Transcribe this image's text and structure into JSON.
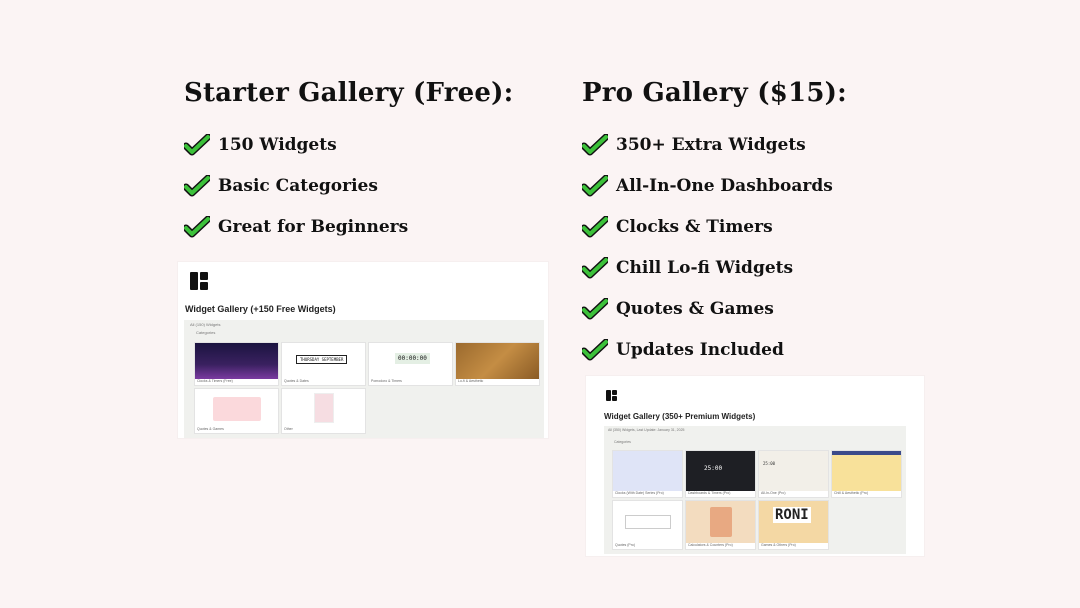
{
  "starter": {
    "heading": "Starter Gallery (Free):",
    "features": [
      "150 Widgets",
      "Basic Categories",
      "Great for Beginners"
    ],
    "screenshot": {
      "title": "Widget Gallery (+150 Free Widgets)",
      "board_label": "All (150) Widgets",
      "board_sub": "Categories",
      "cards": [
        {
          "caption": "Clocks & Timers (Free)",
          "thumb_text": ""
        },
        {
          "caption": "Quotes & Dates",
          "thumb_text": "THURSDAY  SEPTEMBER"
        },
        {
          "caption": "Pomodoro & Timers",
          "thumb_text": "00:00:00"
        },
        {
          "caption": "Lo-fi & Aesthetic",
          "thumb_text": ""
        },
        {
          "caption": "Quotes & Games",
          "thumb_text": ""
        },
        {
          "caption": "Other",
          "thumb_text": ""
        }
      ]
    }
  },
  "pro": {
    "heading": "Pro Gallery ($15):",
    "features": [
      "350+ Extra Widgets",
      "All-In-One Dashboards",
      "Clocks & Timers",
      "Chill Lo-fi Widgets",
      "Quotes & Games",
      "Updates Included"
    ],
    "screenshot": {
      "title": "Widget Gallery (350+ Premium Widgets)",
      "board_label": "All (350) Widgets, Last Update: January 31, 2025",
      "board_sub": "Categories",
      "cards": [
        {
          "caption": "Clocks (With Date) Series (Pro)",
          "thumb_text": ""
        },
        {
          "caption": "Dashboards & Timers (Pro)",
          "thumb_text": "25:00"
        },
        {
          "caption": "All-In-One (Pro)",
          "thumb_text": "25:00"
        },
        {
          "caption": "Chill & Aesthetic (Pro)",
          "thumb_text": ""
        },
        {
          "caption": "Quotes (Pro)",
          "thumb_text": ""
        },
        {
          "caption": "Calculators & Counters (Pro)",
          "thumb_text": ""
        },
        {
          "caption": "Games & Others (Pro)",
          "thumb_text": "RONI"
        }
      ]
    }
  },
  "colors": {
    "background": "#fbf4f4",
    "check_green": "#3cc13a",
    "check_outline": "#111111"
  },
  "icons": {
    "feature_bullet": "checkmark-icon",
    "gallery_logo": "grid-logo-icon"
  }
}
